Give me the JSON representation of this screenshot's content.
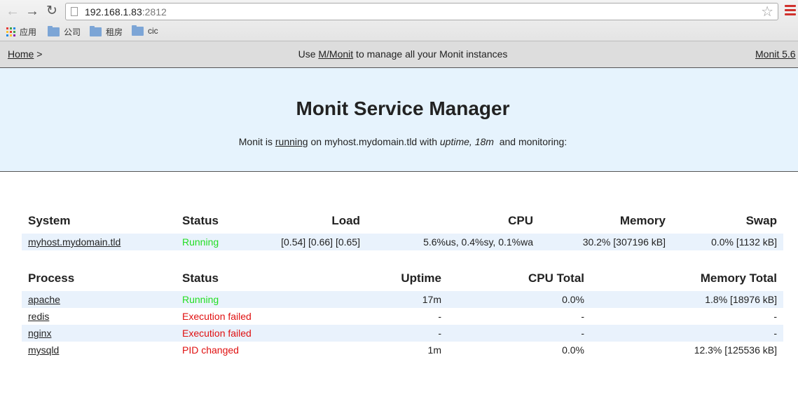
{
  "browser": {
    "url_host": "192.168.1.83",
    "url_port": ":2812",
    "bookmarks": [
      {
        "label": "应用",
        "icon": "apps-grid-icon"
      },
      {
        "label": "公司",
        "icon": "folder-icon"
      },
      {
        "label": "租房",
        "icon": "folder-icon"
      },
      {
        "label": "cic",
        "icon": "folder-icon"
      }
    ],
    "apps_colors": [
      "#e53935",
      "#43a047",
      "#1e88e5",
      "#fbc02d",
      "#e53935",
      "#43a047",
      "#1e88e5",
      "#fbc02d",
      "#8e24aa"
    ]
  },
  "nav": {
    "home": "Home",
    "separator": " >",
    "center_prefix": "Use ",
    "center_link": "M/Monit",
    "center_suffix": " to manage all your Monit instances",
    "version": "Monit 5.6"
  },
  "header": {
    "title": "Monit Service Manager",
    "sub_prefix": "Monit is ",
    "sub_link": "running",
    "sub_middle": " on myhost.mydomain.tld with ",
    "sub_uptime": "uptime, 18m",
    "sub_suffix": "  and monitoring:"
  },
  "system_table": {
    "headers": [
      "System",
      "Status",
      "Load",
      "CPU",
      "Memory",
      "Swap"
    ],
    "rows": [
      {
        "name": "myhost.mydomain.tld",
        "status": "Running",
        "load": "[0.54] [0.66] [0.65]",
        "cpu": "5.6%us, 0.4%sy, 0.1%wa",
        "memory": "30.2% [307196 kB]",
        "swap": "0.0% [1132 kB]"
      }
    ]
  },
  "process_table": {
    "headers": [
      "Process",
      "Status",
      "Uptime",
      "CPU Total",
      "Memory Total"
    ],
    "rows": [
      {
        "name": "apache",
        "status": "Running",
        "uptime": "17m",
        "cpu": "0.0%",
        "memory": "1.8% [18976 kB]"
      },
      {
        "name": "redis",
        "status": "Execution failed",
        "uptime": "-",
        "cpu": "-",
        "memory": "-"
      },
      {
        "name": "nginx",
        "status": "Execution failed",
        "uptime": "-",
        "cpu": "-",
        "memory": "-"
      },
      {
        "name": "mysqld",
        "status": "PID changed",
        "uptime": "1m",
        "cpu": "0.0%",
        "memory": "12.3% [125536 kB]"
      }
    ]
  },
  "colors": {
    "status_ok": "#22dd22",
    "status_fail": "#e01010"
  }
}
